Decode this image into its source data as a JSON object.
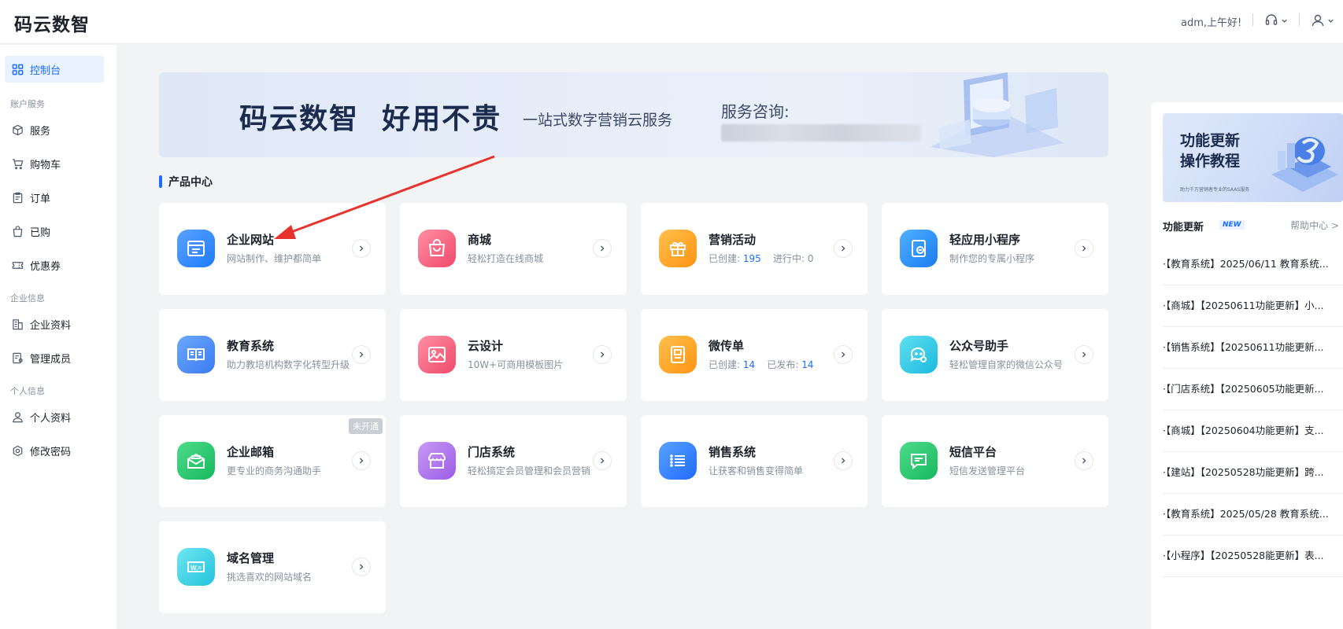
{
  "app": {
    "logo": "码云数智"
  },
  "header": {
    "greeting": "adm,上午好!"
  },
  "sidebar": {
    "items": [
      {
        "label": "控制台"
      },
      {
        "label": "服务"
      },
      {
        "label": "购物车"
      },
      {
        "label": "订单"
      },
      {
        "label": "已购"
      },
      {
        "label": "优惠券"
      },
      {
        "label": "企业资料"
      },
      {
        "label": "管理成员"
      },
      {
        "label": "个人资料"
      },
      {
        "label": "修改密码"
      }
    ],
    "groups": [
      "账户服务",
      "企业信息",
      "个人信息"
    ]
  },
  "banner": {
    "title": "码云数智  好用不贵",
    "subtitle": "一站式数字营销云服务",
    "consult": "服务咨询:"
  },
  "section": {
    "title": "产品中心"
  },
  "products": [
    {
      "name": "企业网站",
      "desc": "网站制作、维护都简单"
    },
    {
      "name": "商城",
      "desc": "轻松打造在线商城"
    },
    {
      "name": "营销活动",
      "desc_a": "已创建:",
      "num_a": "195",
      "desc_b": "进行中:",
      "num_b": "0"
    },
    {
      "name": "轻应用小程序",
      "desc": "制作您的专属小程序"
    },
    {
      "name": "教育系统",
      "desc": "助力教培机构数字化转型升级"
    },
    {
      "name": "云设计",
      "desc": "10W+可商用模板图片"
    },
    {
      "name": "微传单",
      "desc_a": "已创建:",
      "num_a": "14",
      "desc_b": "已发布:",
      "num_b": "14"
    },
    {
      "name": "公众号助手",
      "desc": "轻松管理自家的微信公众号"
    },
    {
      "name": "企业邮箱",
      "desc": "更专业的商务沟通助手",
      "badge": "未开通"
    },
    {
      "name": "门店系统",
      "desc": "轻松搞定会员管理和会员营销"
    },
    {
      "name": "销售系统",
      "desc": "让获客和销售变得简单"
    },
    {
      "name": "短信平台",
      "desc": "短信发送管理平台"
    },
    {
      "name": "域名管理",
      "desc": "挑选喜欢的网站域名"
    }
  ],
  "right_panel": {
    "tutorial_title_1": "功能更新",
    "tutorial_title_2": "操作教程",
    "tutorial_sub": "助力千万营销者专业的SAAS服务",
    "updates_title": "功能更新",
    "new_badge": "NEW",
    "help": "帮助中心 >",
    "news": [
      "·【教育系统】2025/06/11 教育系统...",
      "·【商城】【20250611功能更新】小...",
      "·【销售系统】【20250611功能更新...",
      "·【门店系统】【20250605功能更新...",
      "·【商城】【20250604功能更新】支...",
      "·【建站】【20250528功能更新】跨...",
      "·【教育系统】2025/05/28 教育系统...",
      "·【小程序】【20250528能更新】表..."
    ]
  },
  "colors": {
    "primary": "#1e6bff",
    "annotation_arrow": "#e8322d"
  }
}
